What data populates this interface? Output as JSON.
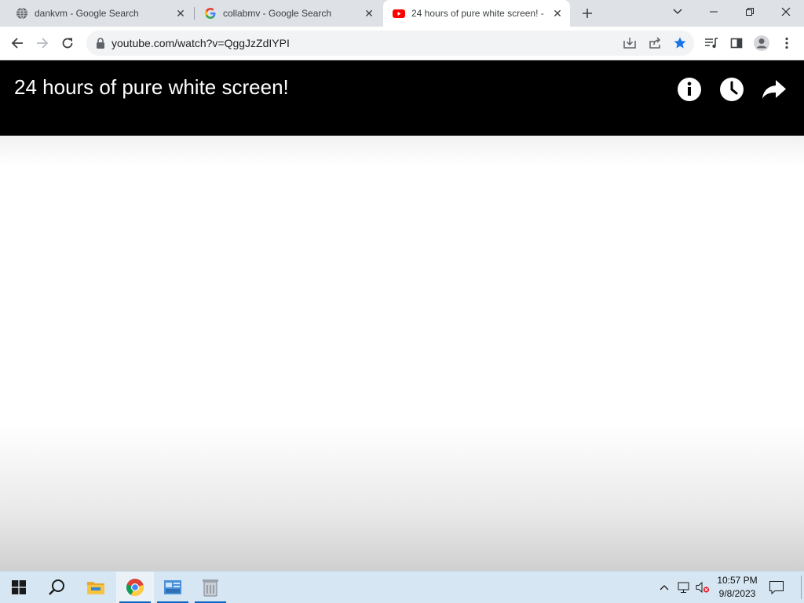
{
  "browser": {
    "tabs": [
      {
        "title": "dankvm - Google Search",
        "icon": "globe-icon"
      },
      {
        "title": "collabmv - Google Search",
        "icon": "google-g-icon"
      },
      {
        "title": "24 hours of pure white screen! -",
        "icon": "youtube-icon",
        "active": true
      }
    ],
    "address_bar": {
      "url": "youtube.com/watch?v=QggJzZdIYPI"
    },
    "accent_color": "#1a73e8"
  },
  "video": {
    "title": "24 hours of pure white screen!",
    "header_icons": [
      "info-icon",
      "watch-later-icon",
      "share-icon"
    ]
  },
  "taskbar": {
    "pinned": [
      "start-icon",
      "search-icon",
      "file-explorer-icon",
      "chrome-icon",
      "control-panel-icon",
      "recycle-bin-icon"
    ],
    "clock": {
      "time": "10:57 PM",
      "date": "9/8/2023"
    }
  }
}
